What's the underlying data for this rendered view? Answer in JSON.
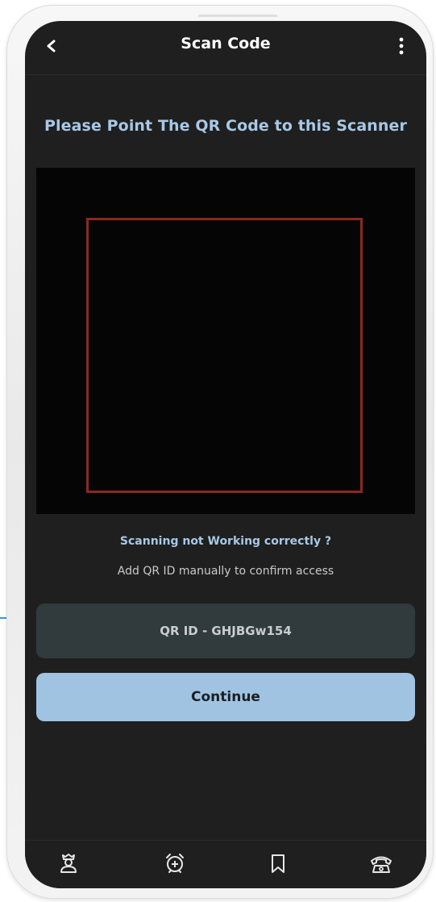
{
  "app_bar": {
    "title": "Scan Code",
    "back_icon": "chevron-left-icon",
    "menu_icon": "more-vertical-icon"
  },
  "scanner": {
    "prompt": "Please Point The QR Code to this Scanner",
    "frame_color": "#8b2820"
  },
  "help": {
    "title": "Scanning not Working correctly ?",
    "subtitle": "Add QR ID manually to confirm access"
  },
  "qr_field": {
    "placeholder": "QR ID - GHJBGw154",
    "value": ""
  },
  "actions": {
    "continue_label": "Continue"
  },
  "bottom_nav": {
    "items": [
      {
        "icon": "guard-icon"
      },
      {
        "icon": "alarm-add-icon"
      },
      {
        "icon": "bookmark-icon"
      },
      {
        "icon": "phone-icon"
      }
    ]
  },
  "colors": {
    "background": "#1f1f1f",
    "accent": "#a0c3e1",
    "heading": "#a7c8e6",
    "field": "#313a3d"
  }
}
